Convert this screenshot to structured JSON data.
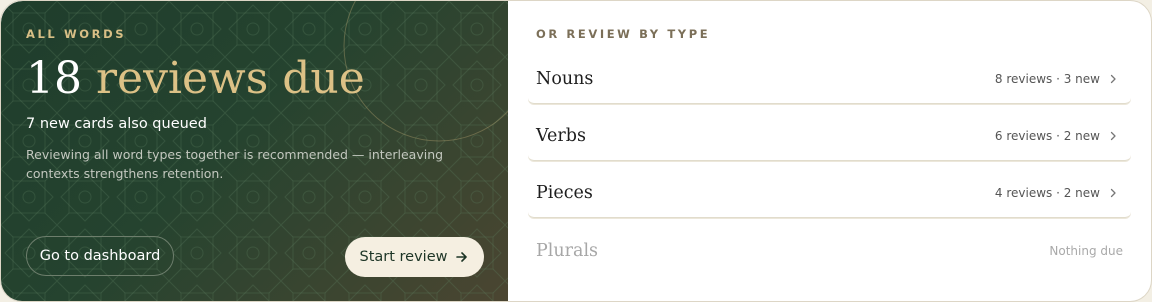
{
  "hero": {
    "eyebrow": "ALL WORDS",
    "count": "18",
    "headline_text": "reviews due",
    "subtitle": "7 new cards also queued",
    "note": "Reviewing all word types together is recommended — interleaving contexts strengthens retention.",
    "dashboard_button": "Go to dashboard",
    "start_button": "Start review"
  },
  "types": {
    "eyebrow": "OR REVIEW BY TYPE",
    "items": [
      {
        "label": "Nouns",
        "meta": "8 reviews · 3 new"
      },
      {
        "label": "Verbs",
        "meta": "6 reviews · 2 new"
      },
      {
        "label": "Pieces",
        "meta": "4 reviews · 2 new"
      },
      {
        "label": "Plurals",
        "meta": "Nothing due"
      }
    ]
  },
  "colors": {
    "hero_green": "#1f3d2c",
    "accent_gold": "#dcc186",
    "cream": "#f5efe1"
  },
  "icons": {
    "start_arrow": "arrow-right-icon",
    "row_chevron": "chevron-right-icon"
  }
}
